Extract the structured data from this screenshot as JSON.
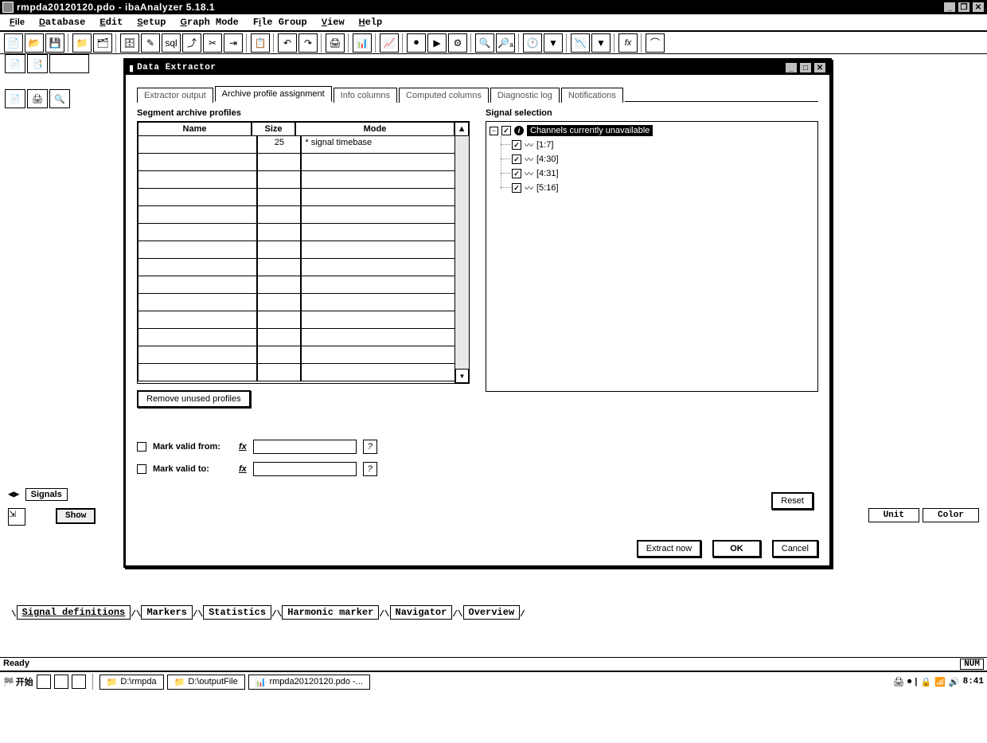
{
  "window": {
    "title": "rmpda20120120.pdo - ibaAnalyzer 5.18.1"
  },
  "menu": [
    "File",
    "Database",
    "Edit",
    "Setup",
    "Graph Mode",
    "File Group",
    "View",
    "Help"
  ],
  "dialog": {
    "title": " Data Extractor",
    "tabs": [
      "Extractor output",
      "Archive profile assignment",
      "Info columns",
      "Computed columns",
      "Diagnostic log",
      "Notifications"
    ],
    "active_tab": 1,
    "segment_label": "Segment archive profiles",
    "grid": {
      "headers": {
        "name": "Name",
        "size": "Size",
        "mode": "Mode"
      },
      "rows": [
        {
          "name": "",
          "size": "25",
          "mode": "* signal timebase"
        }
      ],
      "empty_rows": 13
    },
    "remove_btn": "Remove unused profiles",
    "mark_from": "Mark valid from:",
    "mark_to": "Mark valid to:",
    "signal_label": "Signal selection",
    "tree": {
      "root": "Channels currently unavailable",
      "items": [
        {
          "label": "[1:7]"
        },
        {
          "label": "[4:30]"
        },
        {
          "label": "[4:31]"
        },
        {
          "label": "[5:16]"
        }
      ]
    },
    "reset_btn": "Reset",
    "extract_btn": "Extract now",
    "ok_btn": "OK",
    "cancel_btn": "Cancel"
  },
  "signals_tab": "Signals",
  "show_btn": "Show",
  "unit_col": "Unit",
  "color_col": "Color",
  "bottom_tabs": [
    "Signal definitions",
    "Markers",
    "Statistics",
    "Harmonic marker",
    "Navigator",
    "Overview"
  ],
  "status": {
    "ready": "Ready",
    "num": "NUM"
  },
  "taskbar": {
    "start": "开始",
    "tasks": [
      {
        "label": "D:\\rmpda"
      },
      {
        "label": "D:\\outputFile"
      },
      {
        "label": "rmpda20120120.pdo -..."
      }
    ],
    "time": "8:41"
  }
}
